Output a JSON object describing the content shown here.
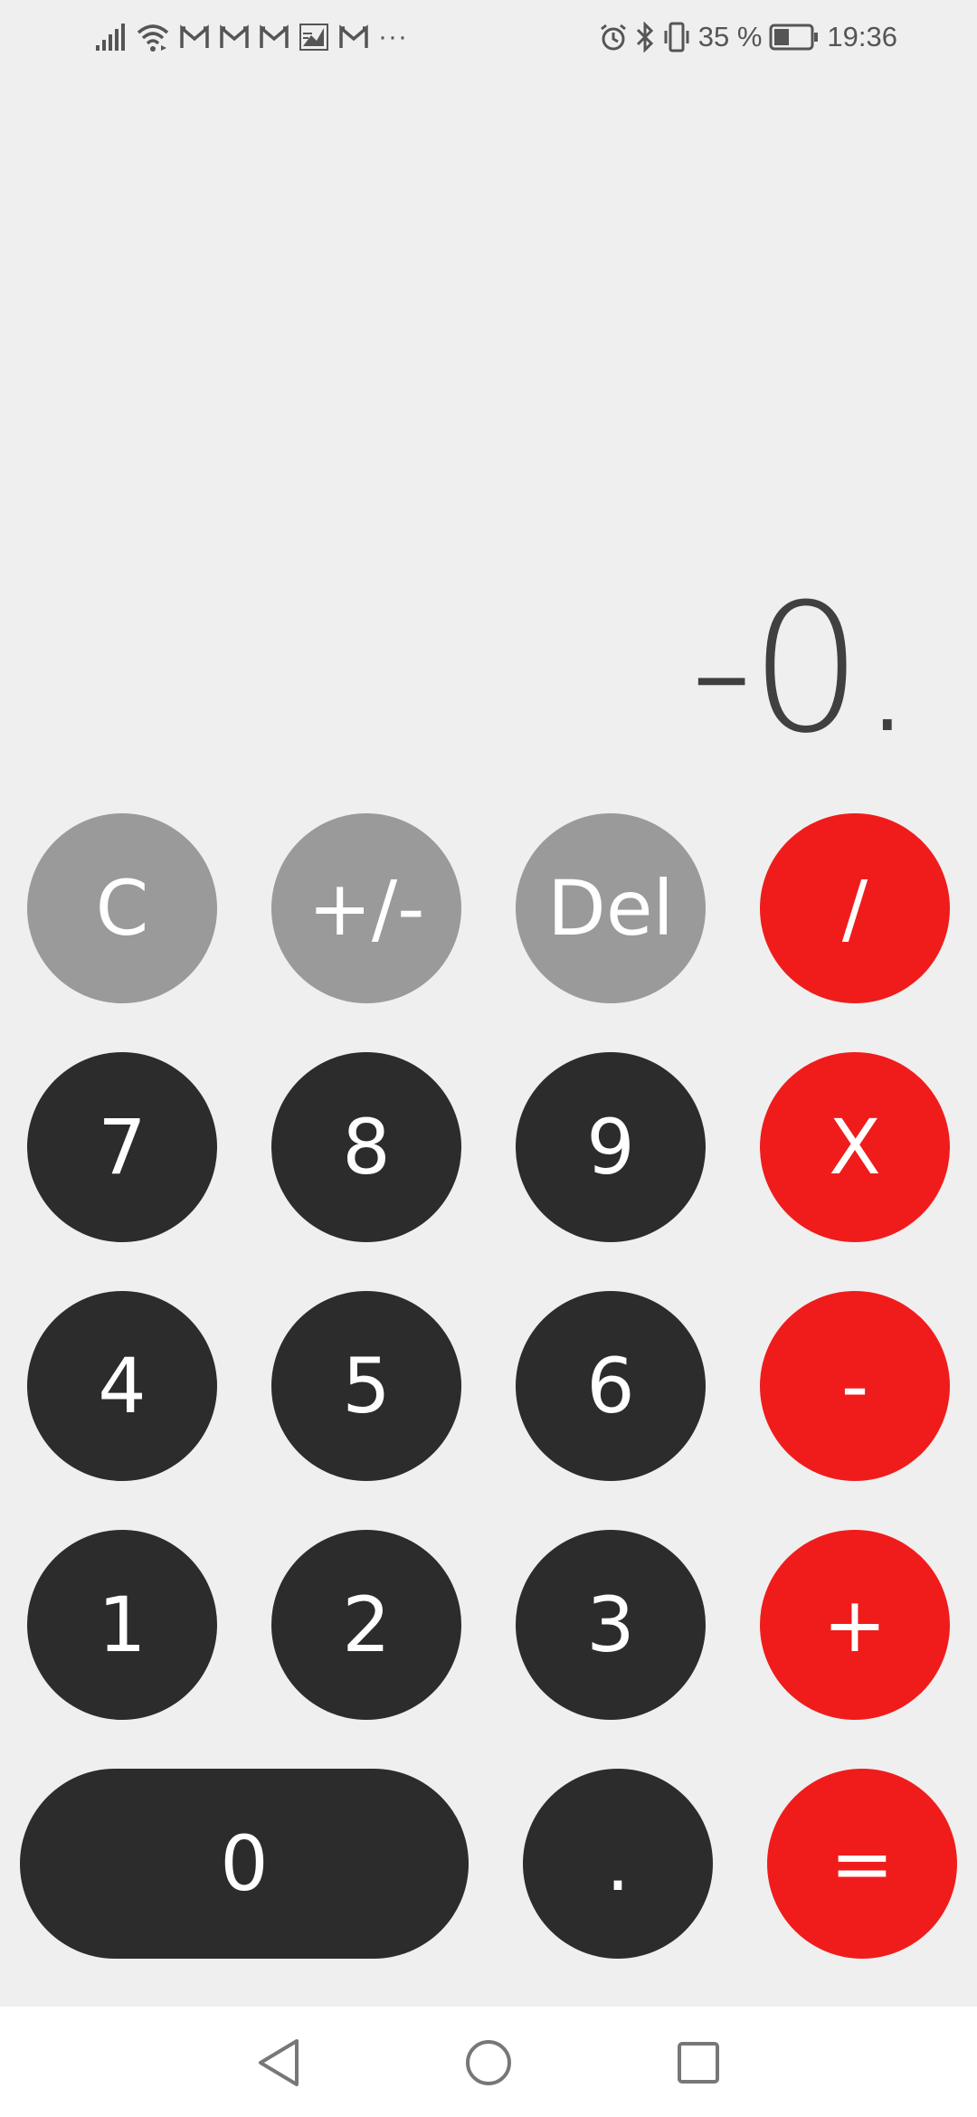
{
  "status_bar": {
    "more_indicator": "···",
    "battery_percent": "35 %",
    "time": "19:36",
    "icons_left": [
      "signal-icon",
      "wifi-icon",
      "gmail-icon",
      "gmail-icon",
      "gmail-icon",
      "image-notification-icon",
      "gmail-icon"
    ],
    "icons_right": [
      "alarm-icon",
      "bluetooth-icon",
      "vibrate-icon",
      "battery-icon"
    ]
  },
  "display": {
    "value": "-0."
  },
  "keys": {
    "clear": "C",
    "sign": "+/-",
    "delete": "Del",
    "divide": "/",
    "seven": "7",
    "eight": "8",
    "nine": "9",
    "multiply": "X",
    "four": "4",
    "five": "5",
    "six": "6",
    "subtract": "-",
    "one": "1",
    "two": "2",
    "three": "3",
    "add": "+",
    "zero": "0",
    "decimal": ".",
    "equals": "="
  },
  "colors": {
    "background": "#efefef",
    "function_key": "#9a9a9a",
    "digit_key": "#2c2c2c",
    "operator_key": "#f01c1c",
    "display_text": "#404040"
  },
  "nav_bar": {
    "icons": [
      "back-icon",
      "home-icon",
      "recents-icon"
    ]
  }
}
